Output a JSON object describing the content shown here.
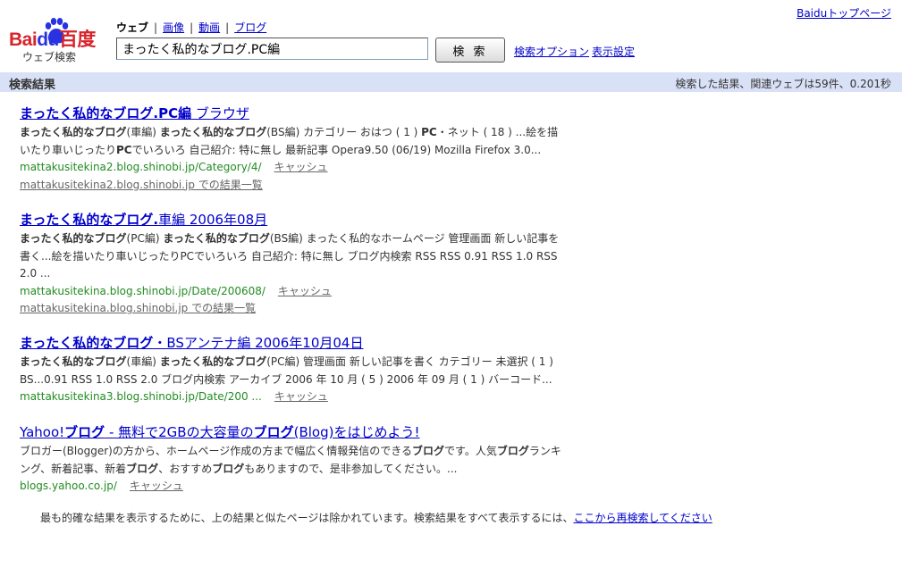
{
  "logo": {
    "text_red": "Bai",
    "text_blue": "du",
    "text_cjk": "百度",
    "subtitle": "ウェブ検索"
  },
  "top_link": "Baiduトップページ",
  "tabs": {
    "current": "ウェブ",
    "items": [
      "画像",
      "動画",
      "ブログ"
    ]
  },
  "search": {
    "value": "まったく私的なブログ.PC編",
    "button_label": "検 索",
    "options_label": "検索オプション",
    "display_settings_label": "表示設定"
  },
  "results_bar": {
    "title": "検索結果",
    "stats": "検索した結果、関連ウェブは59件、0.201秒"
  },
  "results": [
    {
      "title_bold": "まったく私的なブログ.PC編",
      "title_rest": " ブラウザ",
      "snippet_parts": [
        {
          "b": "まったく私的なブログ"
        },
        {
          "t": "(車編) "
        },
        {
          "b": "まったく私的なブログ"
        },
        {
          "t": "(BS編) カテゴリー おはつ ( 1 ) "
        },
        {
          "b": "PC"
        },
        {
          "t": "・ネット ( 18 ) ...絵を描いたり車いじったり"
        },
        {
          "b": "PC"
        },
        {
          "t": "でいろいろ 自己紹介: 特に無し 最新記事 Opera9.50 (06/19) Mozilla Firefox 3.0..."
        }
      ],
      "url": "mattakusitekina2.blog.shinobi.jp/Category/4/",
      "cache": "キャッシュ",
      "more": "mattakusitekina2.blog.shinobi.jp での結果一覧"
    },
    {
      "title_bold": "まったく私的なブログ.",
      "title_rest": "車編 2006年08月",
      "snippet_parts": [
        {
          "b": "まったく私的なブログ"
        },
        {
          "t": "(PC編) "
        },
        {
          "b": "まったく私的なブログ"
        },
        {
          "t": "(BS編) まったく私的なホームページ 管理画面 新しい記事を書く...絵を描いたり車いじったりPCでいろいろ 自己紹介: 特に無し ブログ内検索 RSS RSS 0.91 RSS 1.0 RSS 2.0 ..."
        }
      ],
      "url": "mattakusitekina.blog.shinobi.jp/Date/200608/",
      "cache": "キャッシュ",
      "more": "mattakusitekina.blog.shinobi.jp での結果一覧"
    },
    {
      "title_bold": "まったく私的なブログ",
      "title_rest": "・BSアンテナ編 2006年10月04日",
      "snippet_parts": [
        {
          "b": "まったく私的なブログ"
        },
        {
          "t": "(車編) "
        },
        {
          "b": "まったく私的なブログ"
        },
        {
          "t": "(PC編) 管理画面 新しい記事を書く カテゴリー 未選択 ( 1 ) BS...0.91 RSS 1.0 RSS 2.0 ブログ内検索 アーカイブ 2006 年 10 月 ( 5 ) 2006 年 09 月 ( 1 ) バーコード..."
        }
      ],
      "url": "mattakusitekina3.blog.shinobi.jp/Date/200 ...",
      "cache": "キャッシュ",
      "more": ""
    },
    {
      "title_parts": [
        {
          "t": "Yahoo!"
        },
        {
          "b": "ブログ"
        },
        {
          "t": " - 無料で2GBの大容量の"
        },
        {
          "b": "ブログ"
        },
        {
          "t": "(Blog)をはじめよう!"
        }
      ],
      "snippet_parts": [
        {
          "t": "ブロガー(Blogger)の方から、ホームページ作成の方まで幅広く情報発信のできる"
        },
        {
          "b": "ブログ"
        },
        {
          "t": "です。人気"
        },
        {
          "b": "ブログ"
        },
        {
          "t": "ランキング、新着記事、新着"
        },
        {
          "b": "ブログ"
        },
        {
          "t": "、おすすめ"
        },
        {
          "b": "ブログ"
        },
        {
          "t": "もありますので、是非参加してください。..."
        }
      ],
      "url": "blogs.yahoo.co.jp/",
      "cache": "キャッシュ",
      "more": ""
    }
  ],
  "footer": {
    "note": "最も的確な結果を表示するために、上の結果と似たページは除かれています。検索結果をすべて表示するには、",
    "link": "ここから再検索してください"
  },
  "colors": {
    "bar_bg": "#d9e1f7",
    "link": "#0000cc",
    "url_green": "#228b22",
    "logo_red": "#d8232a",
    "logo_blue": "#2932e1"
  }
}
